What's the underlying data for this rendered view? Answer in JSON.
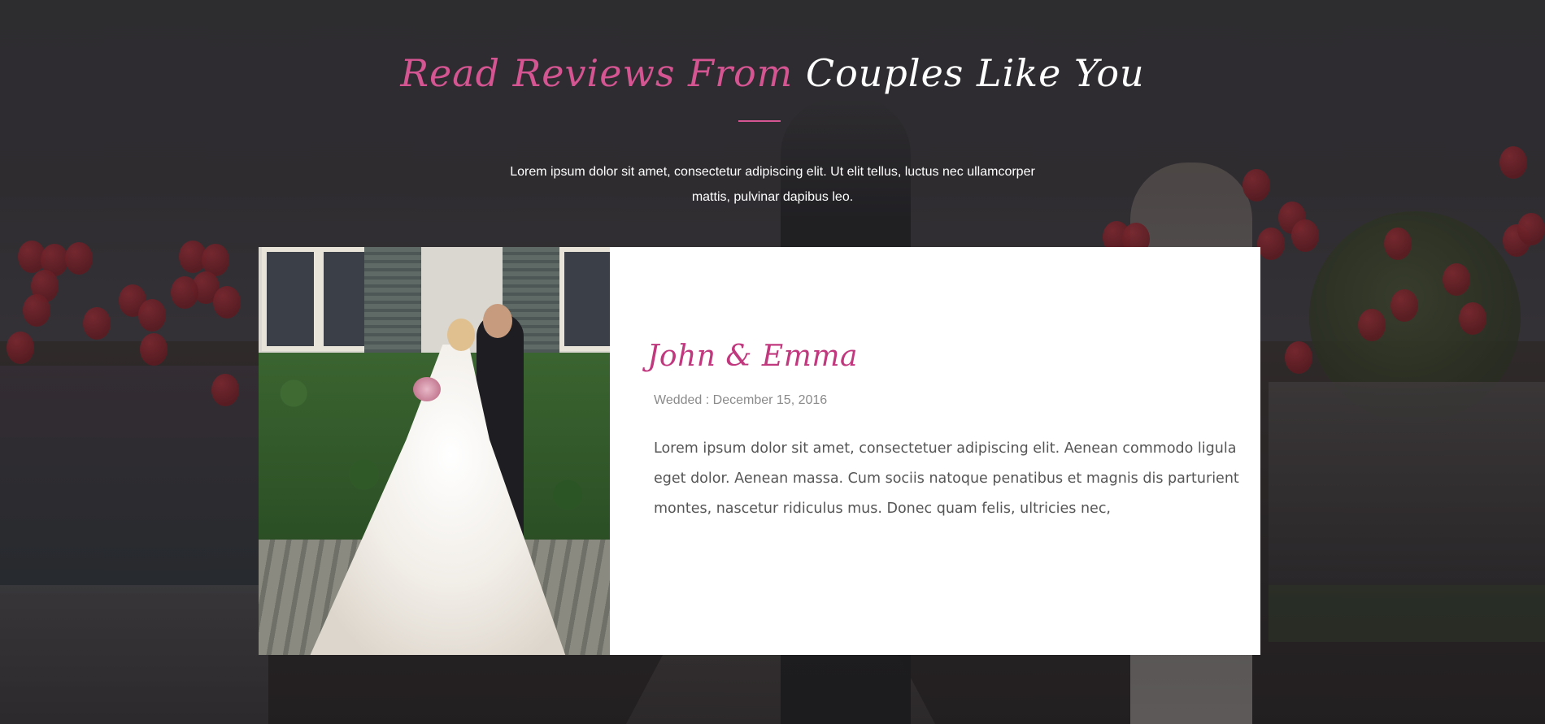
{
  "section": {
    "title_accent": "Read Reviews From",
    "title_main": "Couples Like You",
    "intro": "Lorem ipsum dolor sit amet, consectetur adipiscing elit. Ut elit tellus, luctus nec ullamcorper mattis, pulvinar dapibus leo."
  },
  "review": {
    "couple": "John & Emma",
    "wedded": "Wedded : December 15, 2016",
    "text": "Lorem ipsum dolor sit amet, consectetuer adipiscing elit. Aenean commodo ligula eget dolor. Aenean massa. Cum sociis natoque penatibus et magnis dis parturient montes, nascetur ridiculus mus. Donec quam felis, ultricies nec,"
  },
  "colors": {
    "accent": "#d45592",
    "name": "#c1387f",
    "card": "#ffffff",
    "overlay": "#2e2c30"
  }
}
